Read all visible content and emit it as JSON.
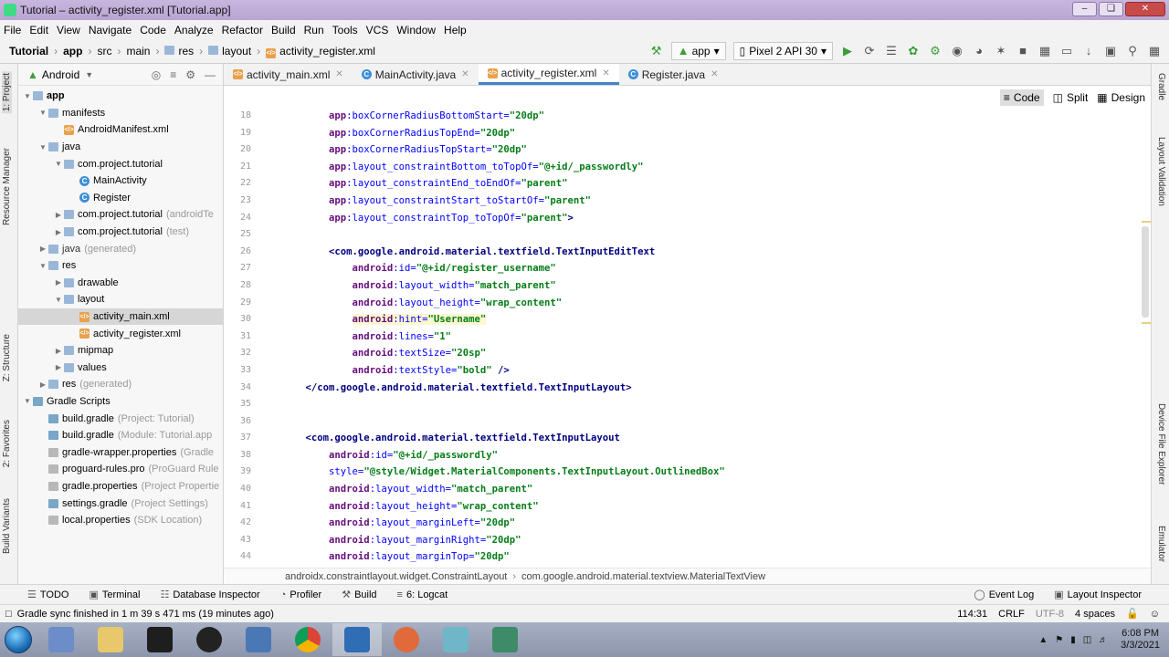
{
  "window": {
    "title": "Tutorial – activity_register.xml [Tutorial.app]"
  },
  "menu": [
    "File",
    "Edit",
    "View",
    "Navigate",
    "Code",
    "Analyze",
    "Refactor",
    "Build",
    "Run",
    "Tools",
    "VCS",
    "Window",
    "Help"
  ],
  "breadcrumb": [
    "Tutorial",
    "app",
    "src",
    "main",
    "res",
    "layout",
    "activity_register.xml"
  ],
  "toolbar": {
    "module": "app",
    "device": "Pixel 2 API 30"
  },
  "left_strip": [
    "1: Project",
    "Resource Manager",
    "Z: Structure",
    "2: Favorites",
    "Build Variants"
  ],
  "right_strip": [
    "Gradle",
    "Layout Validation",
    "Device File Explorer",
    "Emulator"
  ],
  "project_panel": {
    "view_mode": "Android",
    "tree": [
      {
        "label": "app",
        "depth": 0,
        "icon": "folder-icon",
        "bold": true
      },
      {
        "label": "manifests",
        "depth": 1,
        "icon": "folder-icon"
      },
      {
        "label": "AndroidManifest.xml",
        "depth": 2,
        "icon": "xml-file-icon"
      },
      {
        "label": "java",
        "depth": 1,
        "icon": "folder-icon"
      },
      {
        "label": "com.project.tutorial",
        "depth": 2,
        "icon": "package-icon"
      },
      {
        "label": "MainActivity",
        "depth": 3,
        "icon": "class-icon"
      },
      {
        "label": "Register",
        "depth": 3,
        "icon": "class-icon"
      },
      {
        "label": "com.project.tutorial",
        "extra": "(androidTe",
        "depth": 2,
        "icon": "package-icon"
      },
      {
        "label": "com.project.tutorial",
        "extra": "(test)",
        "depth": 2,
        "icon": "package-icon"
      },
      {
        "label": "java",
        "extra": "(generated)",
        "depth": 1,
        "icon": "folder-icon",
        "grey": true
      },
      {
        "label": "res",
        "depth": 1,
        "icon": "folder-icon"
      },
      {
        "label": "drawable",
        "depth": 2,
        "icon": "folder-icon"
      },
      {
        "label": "layout",
        "depth": 2,
        "icon": "folder-icon"
      },
      {
        "label": "activity_main.xml",
        "depth": 3,
        "icon": "xml-file-icon",
        "selected": true
      },
      {
        "label": "activity_register.xml",
        "depth": 3,
        "icon": "xml-file-icon"
      },
      {
        "label": "mipmap",
        "depth": 2,
        "icon": "folder-icon"
      },
      {
        "label": "values",
        "depth": 2,
        "icon": "folder-icon"
      },
      {
        "label": "res",
        "extra": "(generated)",
        "depth": 1,
        "icon": "folder-icon"
      },
      {
        "label": "Gradle Scripts",
        "depth": 0,
        "icon": "gradle-icon"
      },
      {
        "label": "build.gradle",
        "extra": "(Project: Tutorial)",
        "depth": 1,
        "icon": "gradle-icon"
      },
      {
        "label": "build.gradle",
        "extra": "(Module: Tutorial.app",
        "depth": 1,
        "icon": "gradle-icon"
      },
      {
        "label": "gradle-wrapper.properties",
        "extra": "(Gradle",
        "depth": 1,
        "icon": "properties-icon"
      },
      {
        "label": "proguard-rules.pro",
        "extra": "(ProGuard Rule",
        "depth": 1,
        "icon": "properties-icon"
      },
      {
        "label": "gradle.properties",
        "extra": "(Project Propertie",
        "depth": 1,
        "icon": "properties-icon"
      },
      {
        "label": "settings.gradle",
        "extra": "(Project Settings)",
        "depth": 1,
        "icon": "gradle-icon"
      },
      {
        "label": "local.properties",
        "extra": "(SDK Location)",
        "depth": 1,
        "icon": "properties-icon"
      }
    ]
  },
  "editor_tabs": [
    {
      "label": "activity_main.xml",
      "icon": "xml-file-icon",
      "active": false
    },
    {
      "label": "MainActivity.java",
      "icon": "class-icon",
      "active": false
    },
    {
      "label": "activity_register.xml",
      "icon": "xml-file-icon",
      "active": true
    },
    {
      "label": "Register.java",
      "icon": "class-icon",
      "active": false
    }
  ],
  "view_modes": [
    "Code",
    "Split",
    "Design"
  ],
  "code_lines": [
    {
      "n": "18",
      "indent": 2,
      "parts": [
        [
          "ns",
          "app"
        ],
        [
          "at",
          ":boxCornerRadiusBottomStart="
        ],
        [
          "v",
          "\"20dp\""
        ]
      ]
    },
    {
      "n": "19",
      "indent": 2,
      "parts": [
        [
          "ns",
          "app"
        ],
        [
          "at",
          ":boxCornerRadiusTopEnd="
        ],
        [
          "v",
          "\"20dp\""
        ]
      ]
    },
    {
      "n": "20",
      "indent": 2,
      "parts": [
        [
          "ns",
          "app"
        ],
        [
          "at",
          ":boxCornerRadiusTopStart="
        ],
        [
          "v",
          "\"20dp\""
        ]
      ]
    },
    {
      "n": "21",
      "indent": 2,
      "parts": [
        [
          "ns",
          "app"
        ],
        [
          "at",
          ":layout_constraintBottom_toTopOf="
        ],
        [
          "v",
          "\"@+id/_passwordly\""
        ]
      ]
    },
    {
      "n": "22",
      "indent": 2,
      "parts": [
        [
          "ns",
          "app"
        ],
        [
          "at",
          ":layout_constraintEnd_toEndOf="
        ],
        [
          "v",
          "\"parent\""
        ]
      ]
    },
    {
      "n": "23",
      "indent": 2,
      "parts": [
        [
          "ns",
          "app"
        ],
        [
          "at",
          ":layout_constraintStart_toStartOf="
        ],
        [
          "v",
          "\"parent\""
        ]
      ]
    },
    {
      "n": "24",
      "indent": 2,
      "parts": [
        [
          "ns",
          "app"
        ],
        [
          "at",
          ":layout_constraintTop_toTopOf="
        ],
        [
          "v",
          "\"parent\""
        ],
        [
          "tg",
          ">"
        ]
      ]
    },
    {
      "n": "25",
      "indent": 0,
      "parts": []
    },
    {
      "n": "26",
      "indent": 2,
      "parts": [
        [
          "tg",
          "<com.google.android.material.textfield.TextInputEditText"
        ]
      ]
    },
    {
      "n": "27",
      "indent": 3,
      "parts": [
        [
          "ns",
          "android"
        ],
        [
          "at",
          ":id="
        ],
        [
          "v",
          "\"@+id/register_username\""
        ]
      ]
    },
    {
      "n": "28",
      "indent": 3,
      "parts": [
        [
          "ns",
          "android"
        ],
        [
          "at",
          ":layout_width="
        ],
        [
          "v",
          "\"match_parent\""
        ]
      ]
    },
    {
      "n": "29",
      "indent": 3,
      "parts": [
        [
          "ns",
          "android"
        ],
        [
          "at",
          ":layout_height="
        ],
        [
          "v",
          "\"wrap_content\""
        ]
      ]
    },
    {
      "n": "30",
      "indent": 3,
      "hl": true,
      "parts": [
        [
          "ns",
          "android"
        ],
        [
          "at",
          ":hint="
        ],
        [
          "v",
          "\"Username\""
        ]
      ]
    },
    {
      "n": "31",
      "indent": 3,
      "parts": [
        [
          "ns",
          "android"
        ],
        [
          "at",
          ":lines="
        ],
        [
          "v",
          "\"1\""
        ]
      ]
    },
    {
      "n": "32",
      "indent": 3,
      "parts": [
        [
          "ns",
          "android"
        ],
        [
          "at",
          ":textSize="
        ],
        [
          "v",
          "\"20sp\""
        ]
      ]
    },
    {
      "n": "33",
      "indent": 3,
      "parts": [
        [
          "ns",
          "android"
        ],
        [
          "at",
          ":textStyle="
        ],
        [
          "v",
          "\"bold\""
        ],
        [
          "tg",
          " />"
        ]
      ]
    },
    {
      "n": "34",
      "indent": 1,
      "parts": [
        [
          "tg",
          "</com.google.android.material.textfield.TextInputLayout>"
        ]
      ]
    },
    {
      "n": "35",
      "indent": 0,
      "parts": []
    },
    {
      "n": "36",
      "indent": 0,
      "parts": []
    },
    {
      "n": "37",
      "indent": 1,
      "parts": [
        [
          "tg",
          "<com.google.android.material.textfield.TextInputLayout"
        ]
      ]
    },
    {
      "n": "38",
      "indent": 2,
      "parts": [
        [
          "ns",
          "android"
        ],
        [
          "at",
          ":id="
        ],
        [
          "v",
          "\"@+id/_passwordly\""
        ]
      ]
    },
    {
      "n": "39",
      "indent": 2,
      "parts": [
        [
          "at",
          "style="
        ],
        [
          "v",
          "\"@style/Widget.MaterialComponents.TextInputLayout.OutlinedBox\""
        ]
      ]
    },
    {
      "n": "40",
      "indent": 2,
      "parts": [
        [
          "ns",
          "android"
        ],
        [
          "at",
          ":layout_width="
        ],
        [
          "v",
          "\"match_parent\""
        ]
      ]
    },
    {
      "n": "41",
      "indent": 2,
      "parts": [
        [
          "ns",
          "android"
        ],
        [
          "at",
          ":layout_height="
        ],
        [
          "v",
          "\"wrap_content\""
        ]
      ]
    },
    {
      "n": "42",
      "indent": 2,
      "parts": [
        [
          "ns",
          "android"
        ],
        [
          "at",
          ":layout_marginLeft="
        ],
        [
          "v",
          "\"20dp\""
        ]
      ]
    },
    {
      "n": "43",
      "indent": 2,
      "parts": [
        [
          "ns",
          "android"
        ],
        [
          "at",
          ":layout_marginRight="
        ],
        [
          "v",
          "\"20dp\""
        ]
      ]
    },
    {
      "n": "44",
      "indent": 2,
      "parts": [
        [
          "ns",
          "android"
        ],
        [
          "at",
          ":layout_marginTop="
        ],
        [
          "v",
          "\"20dp\""
        ]
      ]
    }
  ],
  "editor_breadcrumb": [
    "androidx.constraintlayout.widget.ConstraintLayout",
    "com.google.android.material.textview.MaterialTextView"
  ],
  "bottom_tools": [
    "TODO",
    "Terminal",
    "Database Inspector",
    "Profiler",
    "Build",
    "6: Logcat"
  ],
  "bottom_tools_right": [
    "Event Log",
    "Layout Inspector"
  ],
  "status": {
    "message": "Gradle sync finished in 1 m 39 s 471 ms (19 minutes ago)",
    "position": "114:31",
    "line_sep": "CRLF",
    "encoding": "UTF-8",
    "indent": "4 spaces"
  },
  "taskbar": {
    "time": "6:08 PM",
    "date": "3/3/2021"
  }
}
